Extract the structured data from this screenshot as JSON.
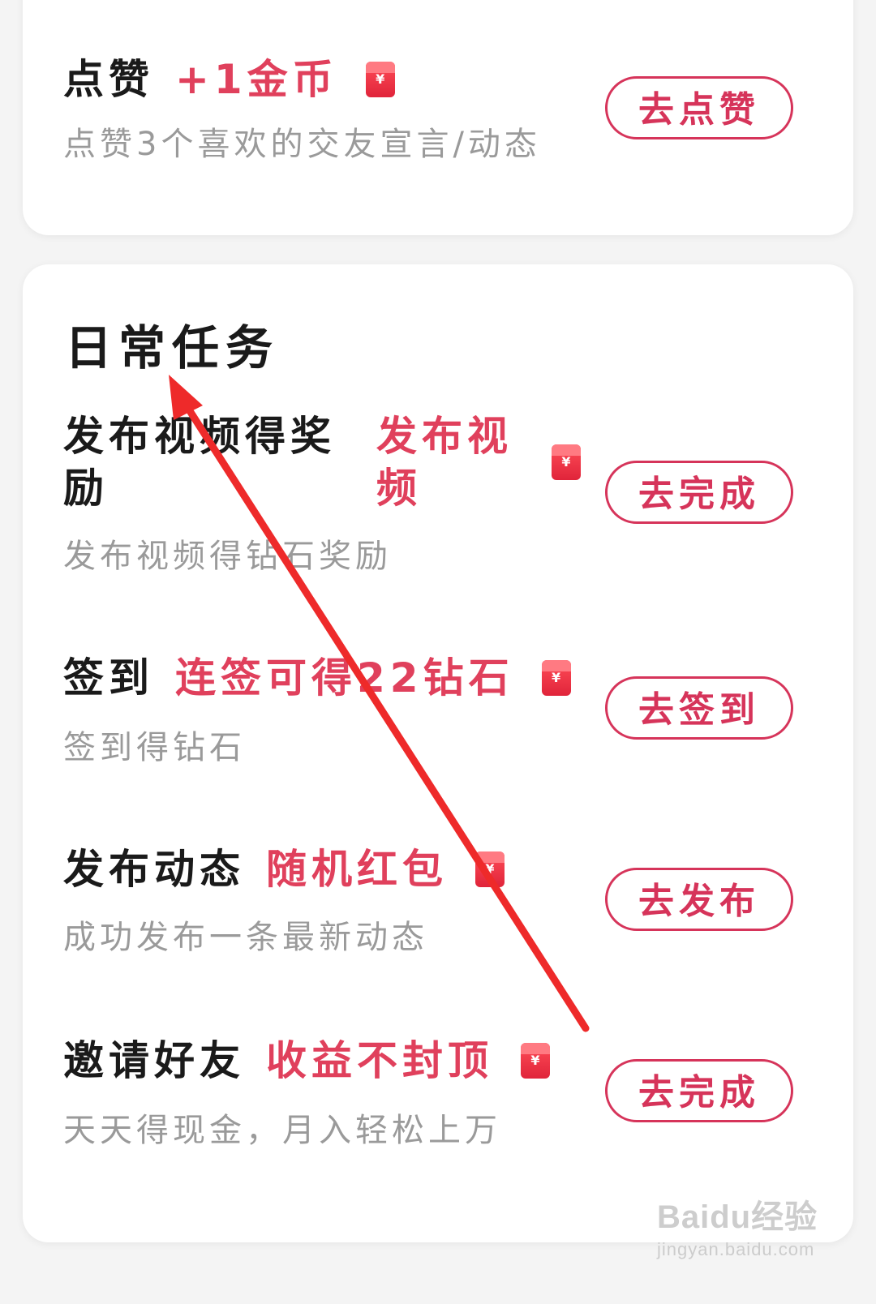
{
  "top_task": {
    "title": "点赞",
    "reward": "+1金币",
    "desc": "点赞3个喜欢的交友宣言/动态",
    "button": "去点赞"
  },
  "daily": {
    "section_title": "日常任务",
    "tasks": [
      {
        "title_line1": "发布视频得奖",
        "title_line2": "励",
        "reward_line1": "发布视",
        "reward_line2": "频",
        "desc": "发布视频得钻石奖励",
        "button": "去完成"
      },
      {
        "title": "签到",
        "reward": "连签可得22钻石",
        "desc": "签到得钻石",
        "button": "去签到"
      },
      {
        "title": "发布动态",
        "reward": "随机红包",
        "desc": "成功发布一条最新动态",
        "button": "去发布"
      },
      {
        "title": "邀请好友",
        "reward": "收益不封顶",
        "desc": "天天得现金，月入轻松上万",
        "button": "去完成"
      }
    ]
  },
  "icons": {
    "redpacket_symbol": "¥"
  },
  "annotation": {
    "arrow_color": "#ee2a2a"
  },
  "watermark": {
    "brand": "Baidu经验",
    "url": "jingyan.baidu.com"
  }
}
